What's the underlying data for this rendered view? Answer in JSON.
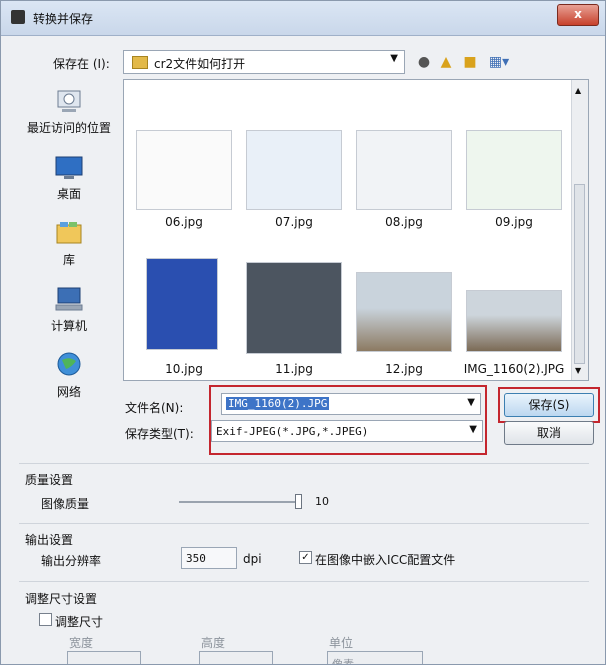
{
  "window": {
    "title": "转换并保存",
    "close_label": "x"
  },
  "lookin": {
    "label": "保存在 (I):",
    "value": "cr2文件如何打开"
  },
  "toolbar": {
    "icons": [
      "back-icon",
      "up-folder-icon",
      "new-folder-icon",
      "view-menu-icon"
    ]
  },
  "places": [
    {
      "label": "最近访问的位置",
      "icon": "recent-places-icon"
    },
    {
      "label": "桌面",
      "icon": "desktop-icon"
    },
    {
      "label": "库",
      "icon": "libraries-icon"
    },
    {
      "label": "计算机",
      "icon": "computer-icon"
    },
    {
      "label": "网络",
      "icon": "network-icon"
    }
  ],
  "files": [
    {
      "name": "06.jpg"
    },
    {
      "name": "07.jpg"
    },
    {
      "name": "08.jpg"
    },
    {
      "name": "09.jpg"
    },
    {
      "name": "10.jpg"
    },
    {
      "name": "11.jpg"
    },
    {
      "name": "12.jpg"
    },
    {
      "name": "IMG_1160(2).JPG"
    }
  ],
  "form": {
    "filename_label": "文件名(N):",
    "filename_value": "IMG_1160(2).JPG",
    "filetype_label": "保存类型(T):",
    "filetype_value": "Exif-JPEG(*.JPG,*.JPEG)",
    "save_label": "保存(S)",
    "cancel_label": "取消"
  },
  "quality": {
    "section_title": "质量设置",
    "label": "图像质量",
    "value": "10",
    "level": 10
  },
  "output": {
    "section_title": "输出设置",
    "resolution_label": "输出分辨率",
    "resolution_value": "350",
    "unit": "dpi",
    "embed_label": "在图像中嵌入ICC配置文件",
    "embed_checked": true
  },
  "resize": {
    "section_title": "调整尺寸设置",
    "checkbox_label": "调整尺寸",
    "width_label": "宽度",
    "height_label": "高度",
    "unit_label": "单位",
    "unit_value": "像素"
  }
}
